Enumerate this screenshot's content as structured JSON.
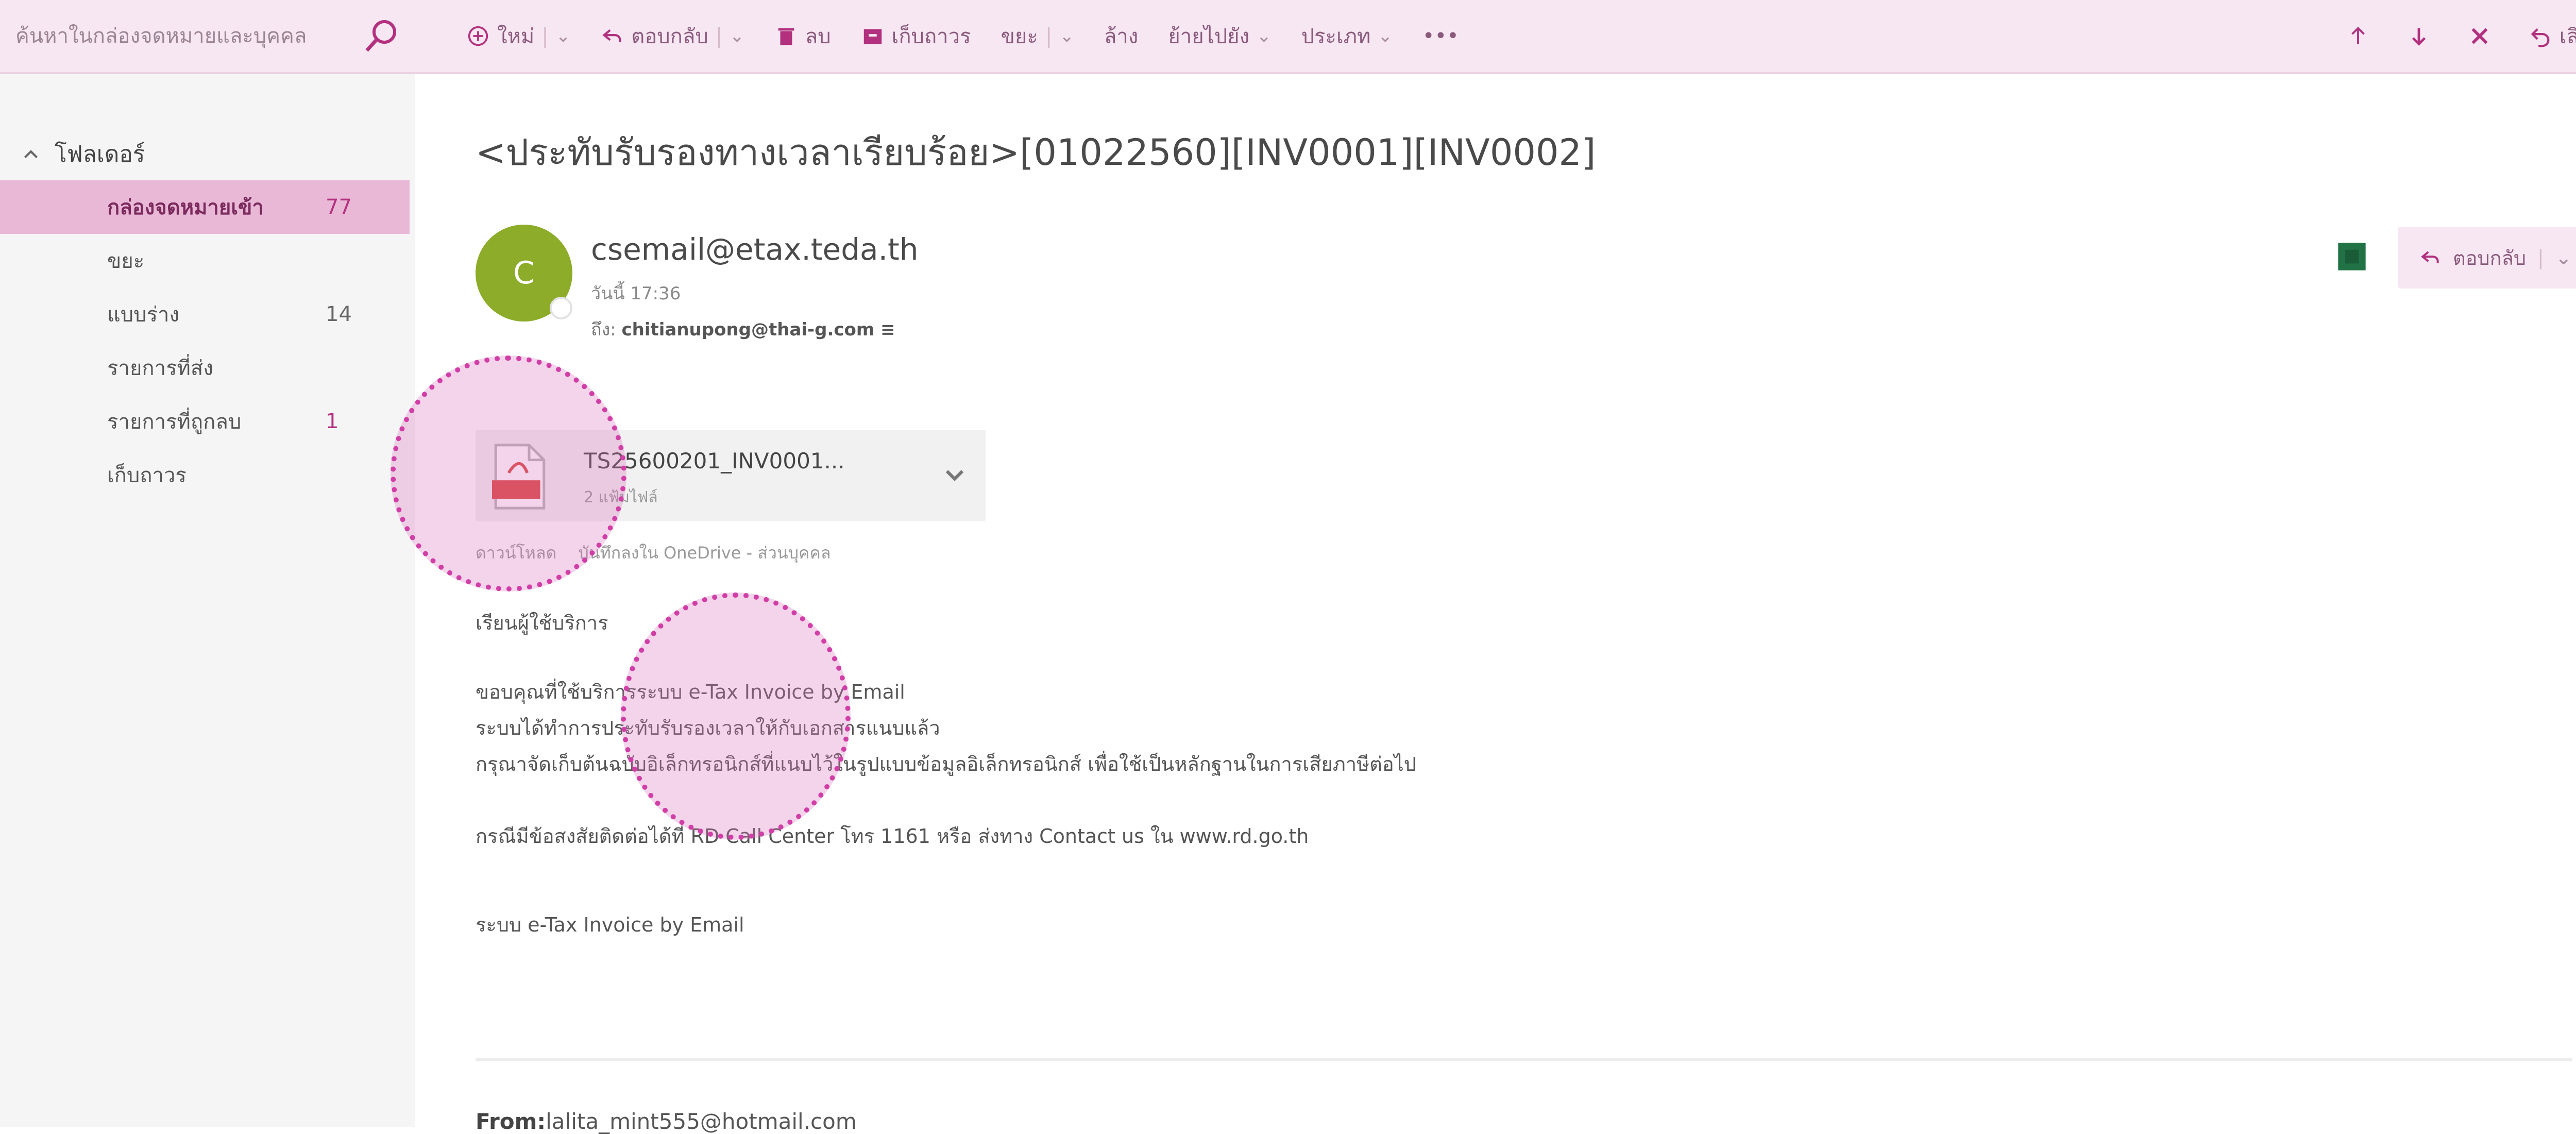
{
  "search": {
    "placeholder": "ค้นหาในกล่องจดหมายและบุคคล"
  },
  "toolbar": {
    "new_label": "ใหม่",
    "reply_label": "ตอบกลับ",
    "delete_label": "ลบ",
    "archive_label": "เก็บถาวร",
    "junk_label": "ขยะ",
    "sweep_label": "ล้าง",
    "move_label": "ย้ายไปยัง",
    "categorize_label": "ประเภท",
    "more_label": "•••",
    "undo_label": "เลิกทำ"
  },
  "sidebar": {
    "header": "โฟลเดอร์",
    "items": [
      {
        "label": "กล่องจดหมายเข้า",
        "count": "77",
        "active": true
      },
      {
        "label": "ขยะ",
        "count": ""
      },
      {
        "label": "แบบร่าง",
        "count": "14"
      },
      {
        "label": "รายการที่ส่ง",
        "count": ""
      },
      {
        "label": "รายการที่ถูกลบ",
        "count": "1"
      },
      {
        "label": "เก็บถาวร",
        "count": ""
      }
    ]
  },
  "message": {
    "subject": "<ประทับรับรองทางเวลาเรียบร้อย>[01022560][INV0001][INV0002]",
    "avatar_letter": "C",
    "sender": "csemail@etax.teda.th",
    "sent_time": "วันนี้ 17:36",
    "to_label": "ถึง:",
    "to_value": "chitianupong@thai-g.com ≡",
    "reply_button_label": "ตอบกลับ",
    "attachment": {
      "name": "TS25600201_INV0001...",
      "size": "2 แฟ้มไฟล์",
      "actions": [
        "ดาวน์โหลด",
        "บันทึกลงใน OneDrive - ส่วนบุคคล"
      ]
    },
    "body": [
      "เรียนผู้ใช้บริการ",
      "ขอบคุณที่ใช้บริการระบบ e-Tax Invoice by Email",
      "ระบบได้ทำการประทับรับรองเวลาให้กับเอกสารแนบแล้ว",
      "กรุณาจัดเก็บต้นฉบับอิเล็กทรอนิกส์ที่แนบไว้ในรูปแบบข้อมูลอิเล็กทรอนิกส์ เพื่อใช้เป็นหลักฐานในการเสียภาษีต่อไป",
      "กรณีมีข้อสงสัยติดต่อได้ที่ RD Call Center โทร 1161 หรือ ส่งทาง Contact us ใน www.rd.go.th",
      "ระบบ e-Tax Invoice by Email"
    ],
    "from_label": "From:",
    "from_value": "lalita_mint555@hotmail.com"
  },
  "colors": {
    "accent": "#b2317f",
    "avatar": "#8cac2a",
    "highlight": "#d13ea6"
  }
}
